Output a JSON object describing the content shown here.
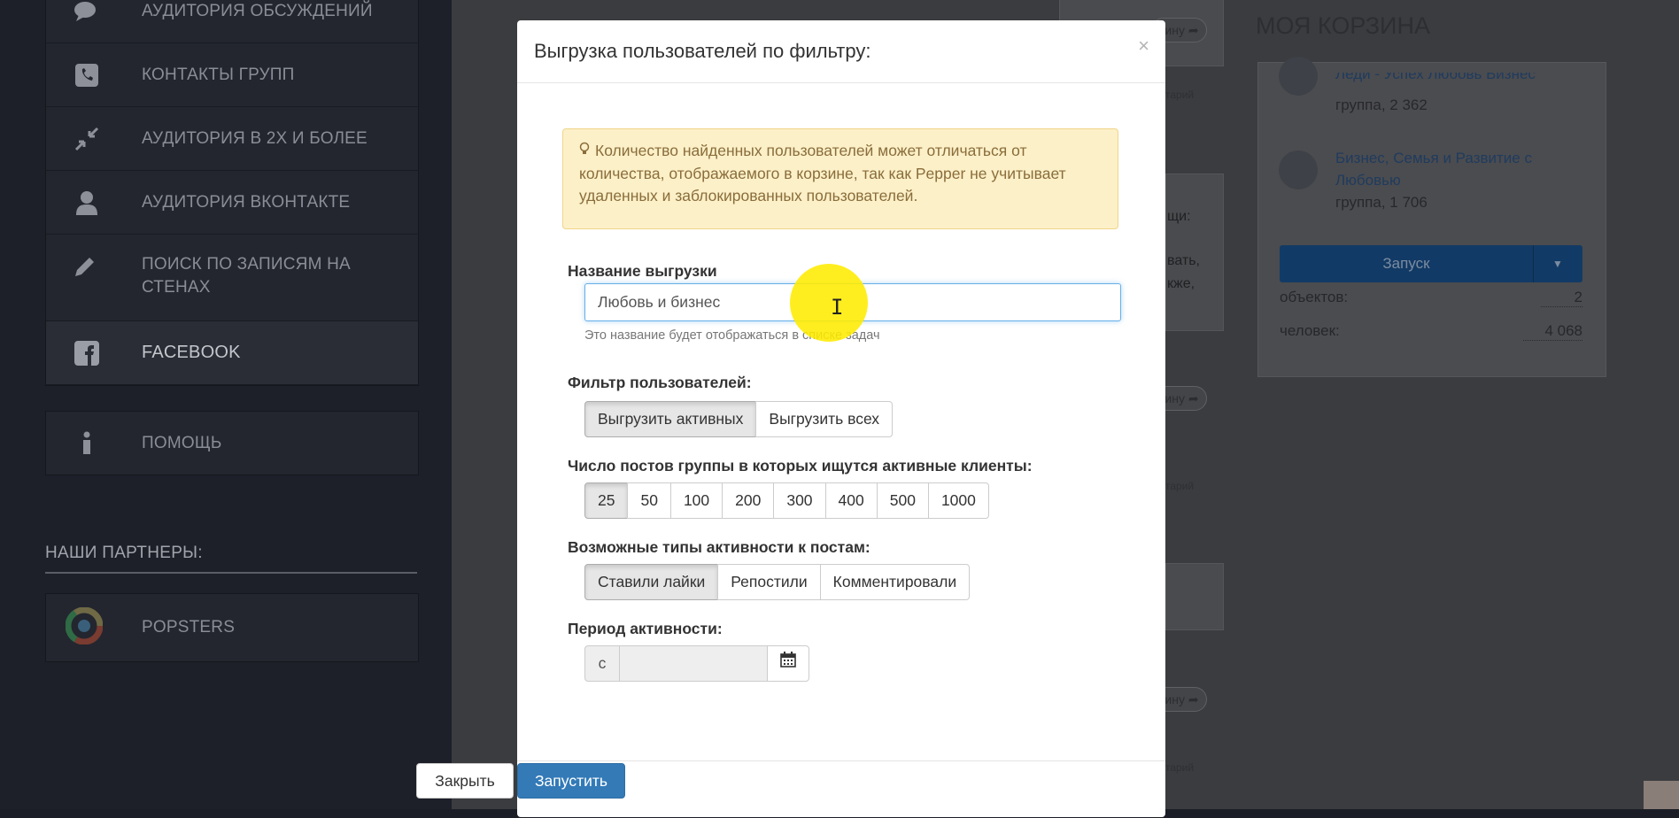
{
  "sidebar": {
    "items": [
      {
        "label": "Аудитория обсуждений",
        "icon": "chat-icon"
      },
      {
        "label": "Контакты групп",
        "icon": "phone-icon"
      },
      {
        "label": "Аудитория в 2х и более",
        "icon": "compress-icon"
      },
      {
        "label": "Аудитория вконтакте",
        "icon": "user-icon"
      },
      {
        "label": "Поиск по записям на стенах",
        "icon": "pencil-icon"
      },
      {
        "label": "Facebook",
        "icon": "facebook-icon"
      }
    ],
    "help": {
      "label": "Помощь",
      "icon": "info-icon"
    },
    "partners_title": "НАШИ ПАРТНЕРЫ:",
    "partner": {
      "label": "POPSTERS",
      "icon": "popsters-logo-icon"
    }
  },
  "background": {
    "share_label": "зину",
    "small_label": "тарий",
    "partial_text": [
      "щи:",
      "вать,",
      "кже,"
    ]
  },
  "basket": {
    "title": "МОЯ КОРЗИНА",
    "groups": [
      {
        "name": "Леди - Успех Любовь Бизнес",
        "sub": "группа, 2 362"
      },
      {
        "name": "Бизнес, Семья и Развитие с Любовью",
        "sub": "группа, 1 706"
      }
    ],
    "run_label": "Запуск",
    "objects_label": "объектов:",
    "objects_value": "2",
    "people_label": "человек:",
    "people_value": "4 068"
  },
  "modal": {
    "title": "Выгрузка пользователей по фильтру:",
    "close_symbol": "×",
    "alert_text": "Количество найденных пользователей может отличаться от количества, отображаемого в корзине, так как Pepper не учитывает удаленных и заблокированных пользователей.",
    "name_label": "Название выгрузки",
    "name_value": "Любовь и бизнес",
    "name_help": "Это название будет отображаться в списке задач",
    "filter_label": "Фильтр пользователей:",
    "filter_options": [
      "Выгрузить активных",
      "Выгрузить всех"
    ],
    "filter_selected": 0,
    "posts_label": "Число постов группы в которых ищутся активные клиенты:",
    "posts_options": [
      "25",
      "50",
      "100",
      "200",
      "300",
      "400",
      "500",
      "1000"
    ],
    "posts_selected": 0,
    "activity_label": "Возможные типы активности к постам:",
    "activity_options": [
      "Ставили лайки",
      "Репостили",
      "Комментировали"
    ],
    "activity_selected": 0,
    "period_label": "Период активности:",
    "period_from": "с",
    "period_value": "",
    "close_button": "Закрыть",
    "run_button": "Запустить"
  }
}
